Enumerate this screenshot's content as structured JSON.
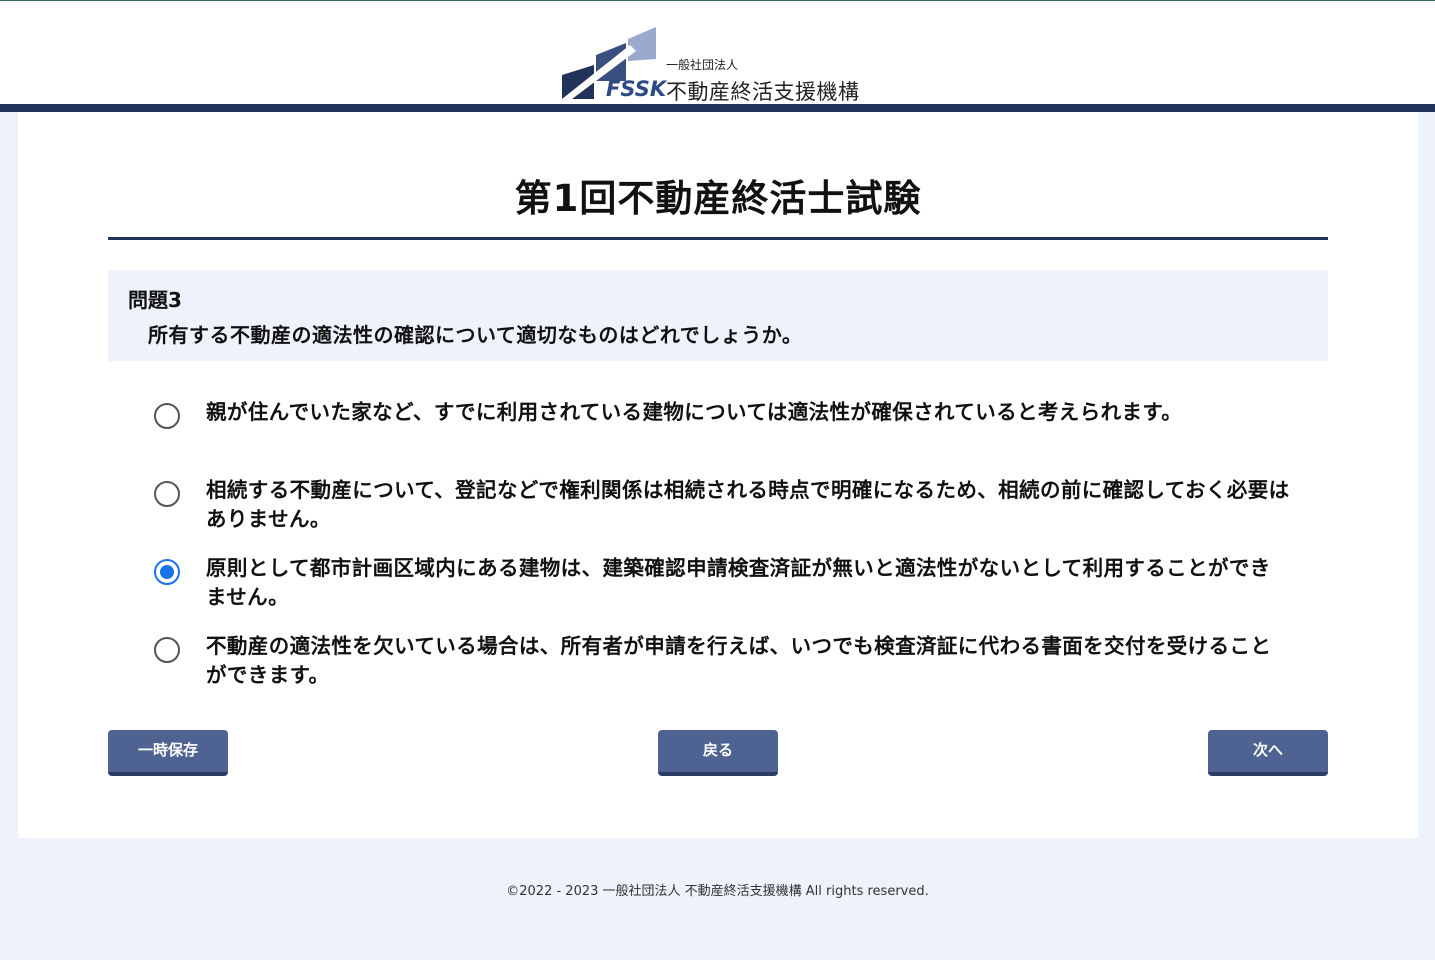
{
  "header": {
    "logo_abbr": "FSSK",
    "org_type": "一般社団法人",
    "org_name": "不動産終活支援機構",
    "logo_colors": {
      "dark": "#22335a",
      "light": "#9aaacf"
    }
  },
  "exam": {
    "title": "第1回不動産終活士試験"
  },
  "question": {
    "number": "問題3",
    "text": "所有する不動産の適法性の確認について適切なものはどれでしょうか。"
  },
  "options": [
    {
      "text": "親が住んでいた家など、すでに利用されている建物については適法性が確保されていると考えられます。",
      "selected": false
    },
    {
      "text": "相続する不動産について、登記などで権利関係は相続される時点で明確になるため、相続の前に確認しておく必要はありません。",
      "selected": false
    },
    {
      "text": "原則として都市計画区域内にある建物は、建築確認申請検査済証が無いと適法性がないとして利用することができません。",
      "selected": true
    },
    {
      "text": "不動産の適法性を欠いている場合は、所有者が申請を行えば、いつでも検査済証に代わる書面を交付を受けることができます。",
      "selected": false
    }
  ],
  "buttons": {
    "save": "一時保存",
    "back": "戻る",
    "next": "次へ"
  },
  "footer": {
    "copyright": "©2022 - 2023 一般社団法人 不動産終活支援機構 All rights reserved."
  },
  "colors": {
    "navy": "#22335a",
    "button": "#4e6391",
    "radio_selected": "#1a73e8",
    "page_bg": "#eef2fb"
  }
}
